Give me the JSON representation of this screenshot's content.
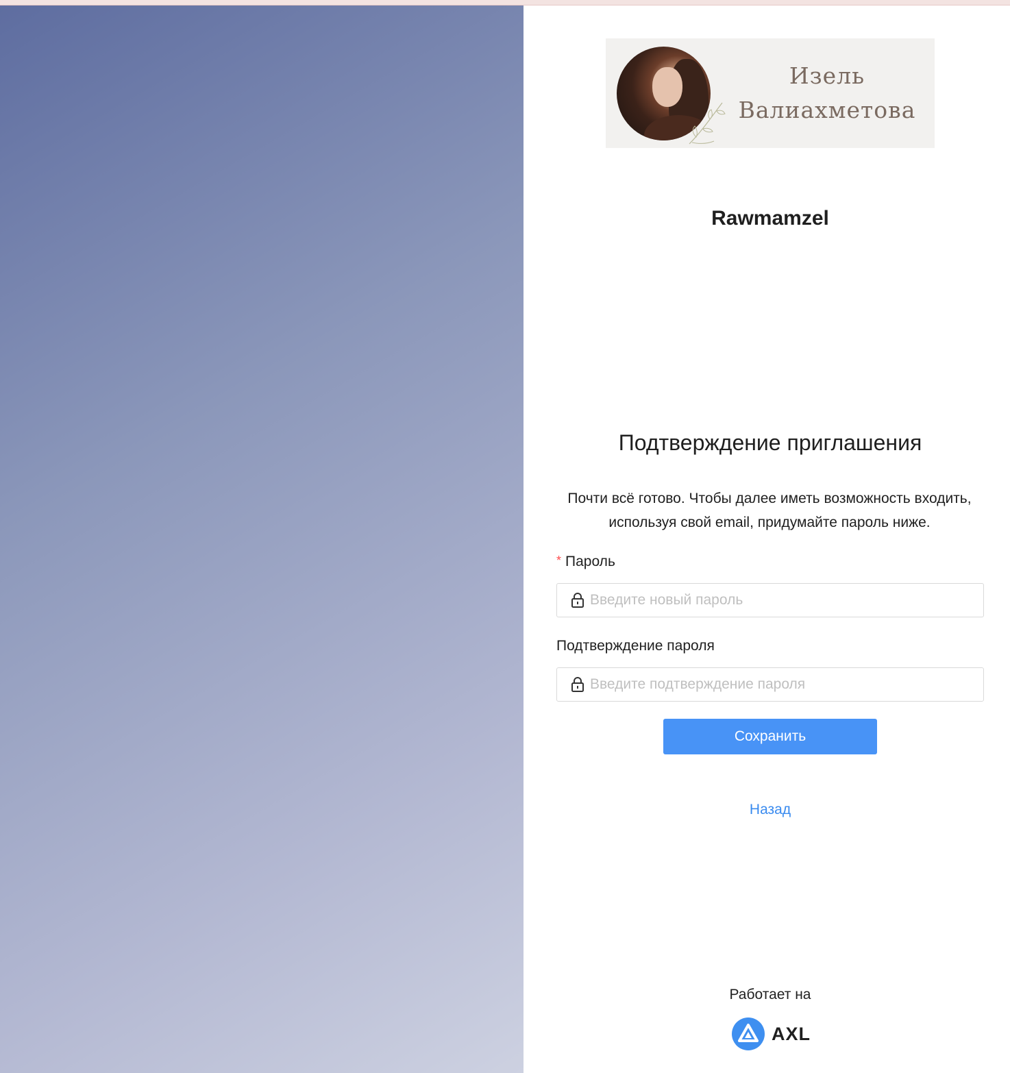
{
  "brand": {
    "banner_line1": "Изель",
    "banner_line2": "Валиахметова",
    "org_name": "Rawmamzel"
  },
  "form": {
    "title": "Подтверждение приглашения",
    "description": "Почти всё готово. Чтобы далее иметь возможность входить, используя свой email, придумайте пароль ниже.",
    "password_label": "Пароль",
    "password_required_mark": "*",
    "password_placeholder": "Введите новый пароль",
    "password_value": "",
    "confirm_label": "Подтверждение пароля",
    "confirm_placeholder": "Введите подтверждение пароля",
    "confirm_value": "",
    "save_label": "Сохранить",
    "back_label": "Назад"
  },
  "footer": {
    "powered_by": "Работает на",
    "provider_name": "AXL"
  },
  "colors": {
    "primary_button": "#4893f6",
    "link": "#3a8bef",
    "required": "#ff4d4f",
    "left_panel_gradient_start": "#5e6da0",
    "left_panel_gradient_end": "#cdd1e1"
  },
  "icons": {
    "lock": "lock-icon",
    "provider_logo": "axl-logo-icon"
  }
}
